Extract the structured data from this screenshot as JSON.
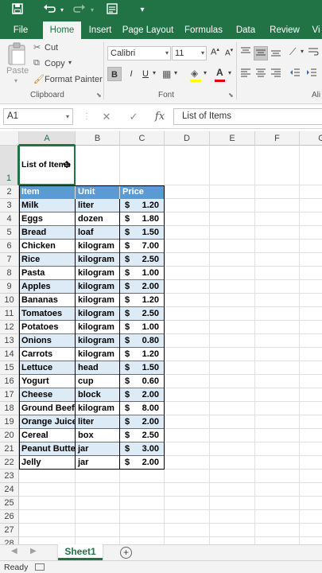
{
  "titlebar": {
    "save_icon": "save-icon",
    "undo_icon": "undo-icon",
    "redo_icon": "redo-icon",
    "form_icon": "form-icon",
    "customize_icon": "chevron-down-icon"
  },
  "tabs": [
    "File",
    "Home",
    "Insert",
    "Page Layout",
    "Formulas",
    "Data",
    "Review",
    "Vi"
  ],
  "active_tab": "Home",
  "ribbon": {
    "paste_label": "Paste",
    "cut_label": "Cut",
    "copy_label": "Copy",
    "format_painter_label": "Format Painter",
    "clipboard_group": "Clipboard",
    "font_name": "Calibri",
    "font_size": "11",
    "bold": "B",
    "italic": "I",
    "underline": "U",
    "font_group": "Font",
    "alignment_group": "Ali"
  },
  "formula_bar": {
    "name_box": "A1",
    "fx": "fx",
    "content": "List of Items"
  },
  "columns": [
    "A",
    "B",
    "C",
    "D",
    "E",
    "F",
    "G"
  ],
  "rows": [
    "1",
    "2",
    "3",
    "4",
    "5",
    "6",
    "7",
    "8",
    "9",
    "10",
    "11",
    "12",
    "13",
    "14",
    "15",
    "16",
    "17",
    "18",
    "19",
    "20",
    "21",
    "22",
    "23",
    "24",
    "25",
    "26",
    "27",
    "28"
  ],
  "cells": {
    "a1": "List of Items"
  },
  "table": {
    "headers": [
      "Item",
      "Unit",
      "Price"
    ],
    "currency_symbol": "$",
    "rows": [
      {
        "item": "Milk",
        "unit": "liter",
        "price": "1.20"
      },
      {
        "item": "Eggs",
        "unit": "dozen",
        "price": "1.80"
      },
      {
        "item": "Bread",
        "unit": "loaf",
        "price": "1.50"
      },
      {
        "item": "Chicken",
        "unit": "kilogram",
        "price": "7.00"
      },
      {
        "item": "Rice",
        "unit": "kilogram",
        "price": "2.50"
      },
      {
        "item": "Pasta",
        "unit": "kilogram",
        "price": "1.00"
      },
      {
        "item": "Apples",
        "unit": "kilogram",
        "price": "2.00"
      },
      {
        "item": "Bananas",
        "unit": "kilogram",
        "price": "1.20"
      },
      {
        "item": "Tomatoes",
        "unit": "kilogram",
        "price": "2.50"
      },
      {
        "item": "Potatoes",
        "unit": "kilogram",
        "price": "1.00"
      },
      {
        "item": "Onions",
        "unit": "kilogram",
        "price": "0.80"
      },
      {
        "item": "Carrots",
        "unit": "kilogram",
        "price": "1.20"
      },
      {
        "item": "Lettuce",
        "unit": "head",
        "price": "1.50"
      },
      {
        "item": "Yogurt",
        "unit": "cup",
        "price": "0.60"
      },
      {
        "item": "Cheese",
        "unit": "block",
        "price": "2.00"
      },
      {
        "item": "Ground Beef",
        "unit": "kilogram",
        "price": "8.00"
      },
      {
        "item": "Orange Juice",
        "unit": "liter",
        "price": "2.00"
      },
      {
        "item": "Cereal",
        "unit": "box",
        "price": "2.50"
      },
      {
        "item": "Peanut Butter",
        "unit": "jar",
        "price": "3.00"
      },
      {
        "item": "Jelly",
        "unit": "jar",
        "price": "2.00"
      }
    ]
  },
  "sheet_tabs": [
    "Sheet1"
  ],
  "status": "Ready",
  "colors": {
    "accent": "#217346",
    "table_header": "#5b9bd5",
    "table_band": "#ddebf7"
  }
}
